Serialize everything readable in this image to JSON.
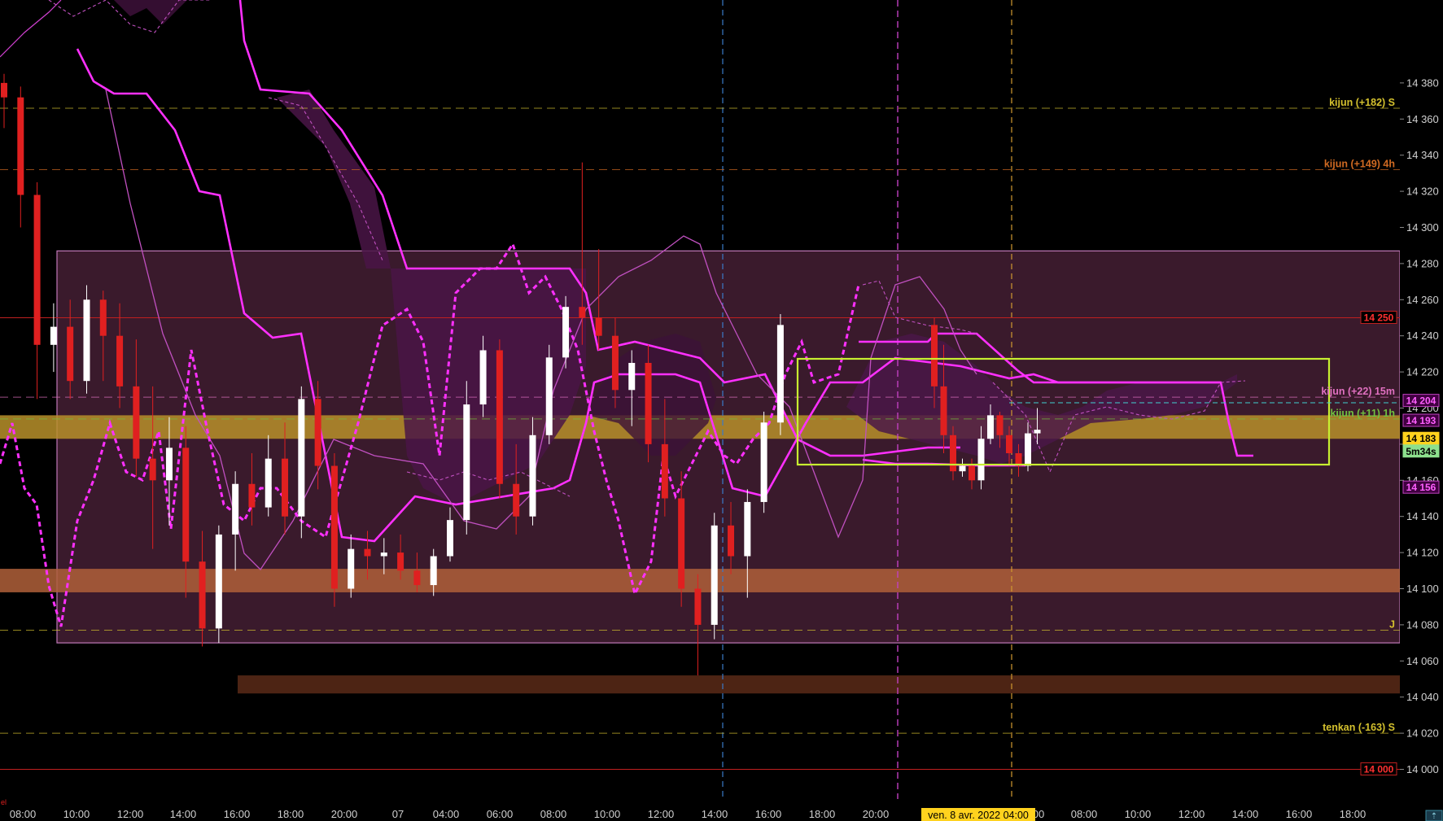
{
  "chart_data": {
    "type": "candlestick",
    "ylim": [
      13990,
      14390
    ],
    "y_ticks": [
      "14 000",
      "14 020",
      "14 040",
      "14 060",
      "14 080",
      "14 100",
      "14 120",
      "14 140",
      "14 160",
      "14 180",
      "14 200",
      "14 220",
      "14 240",
      "14 260",
      "14 280",
      "14 300",
      "14 320",
      "14 340",
      "14 360",
      "14 380"
    ],
    "x_labels": [
      "08:00",
      "10:00",
      "12:00",
      "14:00",
      "16:00",
      "18:00",
      "20:00",
      "07",
      "04:00",
      "06:00",
      "08:00",
      "10:00",
      "12:00",
      "14:00",
      "16:00",
      "18:00",
      "20:00",
      "00",
      "08:00",
      "10:00",
      "12:00",
      "14:00",
      "16:00",
      "18:00"
    ],
    "x_highlight_label": "ven. 8 avr. 2022 04:00",
    "corner_mark": "el",
    "candles": [
      [
        14380,
        14385,
        14355,
        14372
      ],
      [
        14372,
        14378,
        14300,
        14318
      ],
      [
        14318,
        14325,
        14205,
        14235
      ],
      [
        14235,
        14258,
        14220,
        14245
      ],
      [
        14245,
        14260,
        14205,
        14215
      ],
      [
        14215,
        14268,
        14208,
        14260
      ],
      [
        14260,
        14265,
        14215,
        14240
      ],
      [
        14240,
        14258,
        14200,
        14212
      ],
      [
        14212,
        14238,
        14162,
        14172
      ],
      [
        14172,
        14212,
        14122,
        14160
      ],
      [
        14160,
        14195,
        14135,
        14178
      ],
      [
        14178,
        14190,
        14095,
        14115
      ],
      [
        14115,
        14132,
        14068,
        14078
      ],
      [
        14078,
        14135,
        14070,
        14130
      ],
      [
        14130,
        14165,
        14110,
        14158
      ],
      [
        14158,
        14175,
        14135,
        14145
      ],
      [
        14145,
        14185,
        14140,
        14172
      ],
      [
        14172,
        14192,
        14130,
        14140
      ],
      [
        14140,
        14212,
        14128,
        14205
      ],
      [
        14205,
        14215,
        14155,
        14168
      ],
      [
        14168,
        14175,
        14090,
        14100
      ],
      [
        14100,
        14130,
        14095,
        14122
      ],
      [
        14122,
        14132,
        14105,
        14118
      ],
      [
        14118,
        14128,
        14108,
        14120
      ],
      [
        14120,
        14130,
        14105,
        14110
      ],
      [
        14110,
        14120,
        14098,
        14102
      ],
      [
        14102,
        14122,
        14096,
        14118
      ],
      [
        14118,
        14145,
        14115,
        14138
      ],
      [
        14138,
        14215,
        14130,
        14202
      ],
      [
        14202,
        14240,
        14195,
        14232
      ],
      [
        14232,
        14238,
        14150,
        14158
      ],
      [
        14158,
        14180,
        14130,
        14140
      ],
      [
        14140,
        14195,
        14135,
        14185
      ],
      [
        14185,
        14235,
        14180,
        14228
      ],
      [
        14228,
        14262,
        14222,
        14256
      ],
      [
        14256,
        14336,
        14235,
        14250
      ],
      [
        14250,
        14288,
        14232,
        14240
      ],
      [
        14240,
        14250,
        14200,
        14210
      ],
      [
        14210,
        14232,
        14190,
        14225
      ],
      [
        14225,
        14235,
        14170,
        14180
      ],
      [
        14180,
        14205,
        14140,
        14150
      ],
      [
        14150,
        14165,
        14090,
        14100
      ],
      [
        14100,
        14108,
        14052,
        14080
      ],
      [
        14080,
        14142,
        14072,
        14135
      ],
      [
        14135,
        14148,
        14108,
        14118
      ],
      [
        14118,
        14155,
        14095,
        14148
      ],
      [
        14148,
        14198,
        14142,
        14192
      ],
      [
        14192,
        14252,
        14185,
        14246
      ],
      [
        14246,
        14250,
        14200,
        14212
      ],
      [
        14212,
        14235,
        14175,
        14185
      ],
      [
        14185,
        14190,
        14160,
        14165
      ],
      [
        14165,
        14172,
        14162,
        14168
      ],
      [
        14168,
        14172,
        14155,
        14160
      ],
      [
        14160,
        14190,
        14155,
        14183
      ],
      [
        14183,
        14202,
        14180,
        14196
      ],
      [
        14196,
        14198,
        14178,
        14185
      ],
      [
        14185,
        14190,
        14168,
        14175
      ],
      [
        14175,
        14180,
        14162,
        14168
      ],
      [
        14168,
        14192,
        14165,
        14186
      ],
      [
        14186,
        14200,
        14180,
        14188
      ]
    ],
    "horizontal_labels": [
      {
        "text": "kijun (+182) S",
        "value": 14366,
        "color": "#d4c12e"
      },
      {
        "text": "kijun (+149) 4h",
        "value": 14332,
        "color": "#d06a22"
      },
      {
        "text": "kijun (+22) 15m",
        "value": 14206,
        "color": "#e070c0"
      },
      {
        "text": "kijun (+11) 1h",
        "value": 14194,
        "color": "#70c040"
      },
      {
        "text": "J",
        "value": 14077,
        "color": "#d4c12e"
      },
      {
        "text": "tenkan (-163) S",
        "value": 14020,
        "color": "#d4c12e"
      }
    ],
    "price_badges": [
      {
        "text": "14 250",
        "value": 14250,
        "fg": "#ff3030",
        "bg": "#000000",
        "border": "#c02020"
      },
      {
        "text": "14 204",
        "value": 14204,
        "fg": "#ff60ff",
        "bg": "#400040",
        "border": "#c040c0"
      },
      {
        "text": "14 193",
        "value": 14193,
        "fg": "#ff60ff",
        "bg": "#400040",
        "border": "#c040c0"
      },
      {
        "text": "14 183",
        "value": 14183,
        "fg": "#000000",
        "bg": "#ffd21e",
        "border": "#ffd21e"
      },
      {
        "text": "5m34s",
        "value": 14176,
        "fg": "#000000",
        "bg": "#8de08d",
        "border": "#8de08d"
      },
      {
        "text": "14 156",
        "value": 14156,
        "fg": "#ff60ff",
        "bg": "#400040",
        "border": "#c040c0"
      },
      {
        "text": "14 000",
        "value": 14000,
        "fg": "#ff3030",
        "bg": "#000000",
        "border": "#c02020"
      }
    ],
    "zones": [
      {
        "y1": 14287,
        "y2": 14070,
        "fill": "#3a1a2c",
        "stroke": "#c078b8"
      },
      {
        "y1": 14196,
        "y2": 14183,
        "fill": "#b8902a",
        "stroke": "none"
      },
      {
        "y1": 14111,
        "y2": 14098,
        "fill": "#b0603a",
        "stroke": "none"
      },
      {
        "y1": 14052,
        "y2": 14042,
        "fill": "#5a2a18",
        "stroke": "none"
      }
    ],
    "colors": {
      "bull": "#ffffff",
      "bear": "#e02020",
      "cloud": "#7a2a7a",
      "kijun": "#ff30ff",
      "tenkan": "#d050d0",
      "chikou": "#ff30ff",
      "box": "#c8f030",
      "axis_text": "#d0d0d0"
    }
  }
}
